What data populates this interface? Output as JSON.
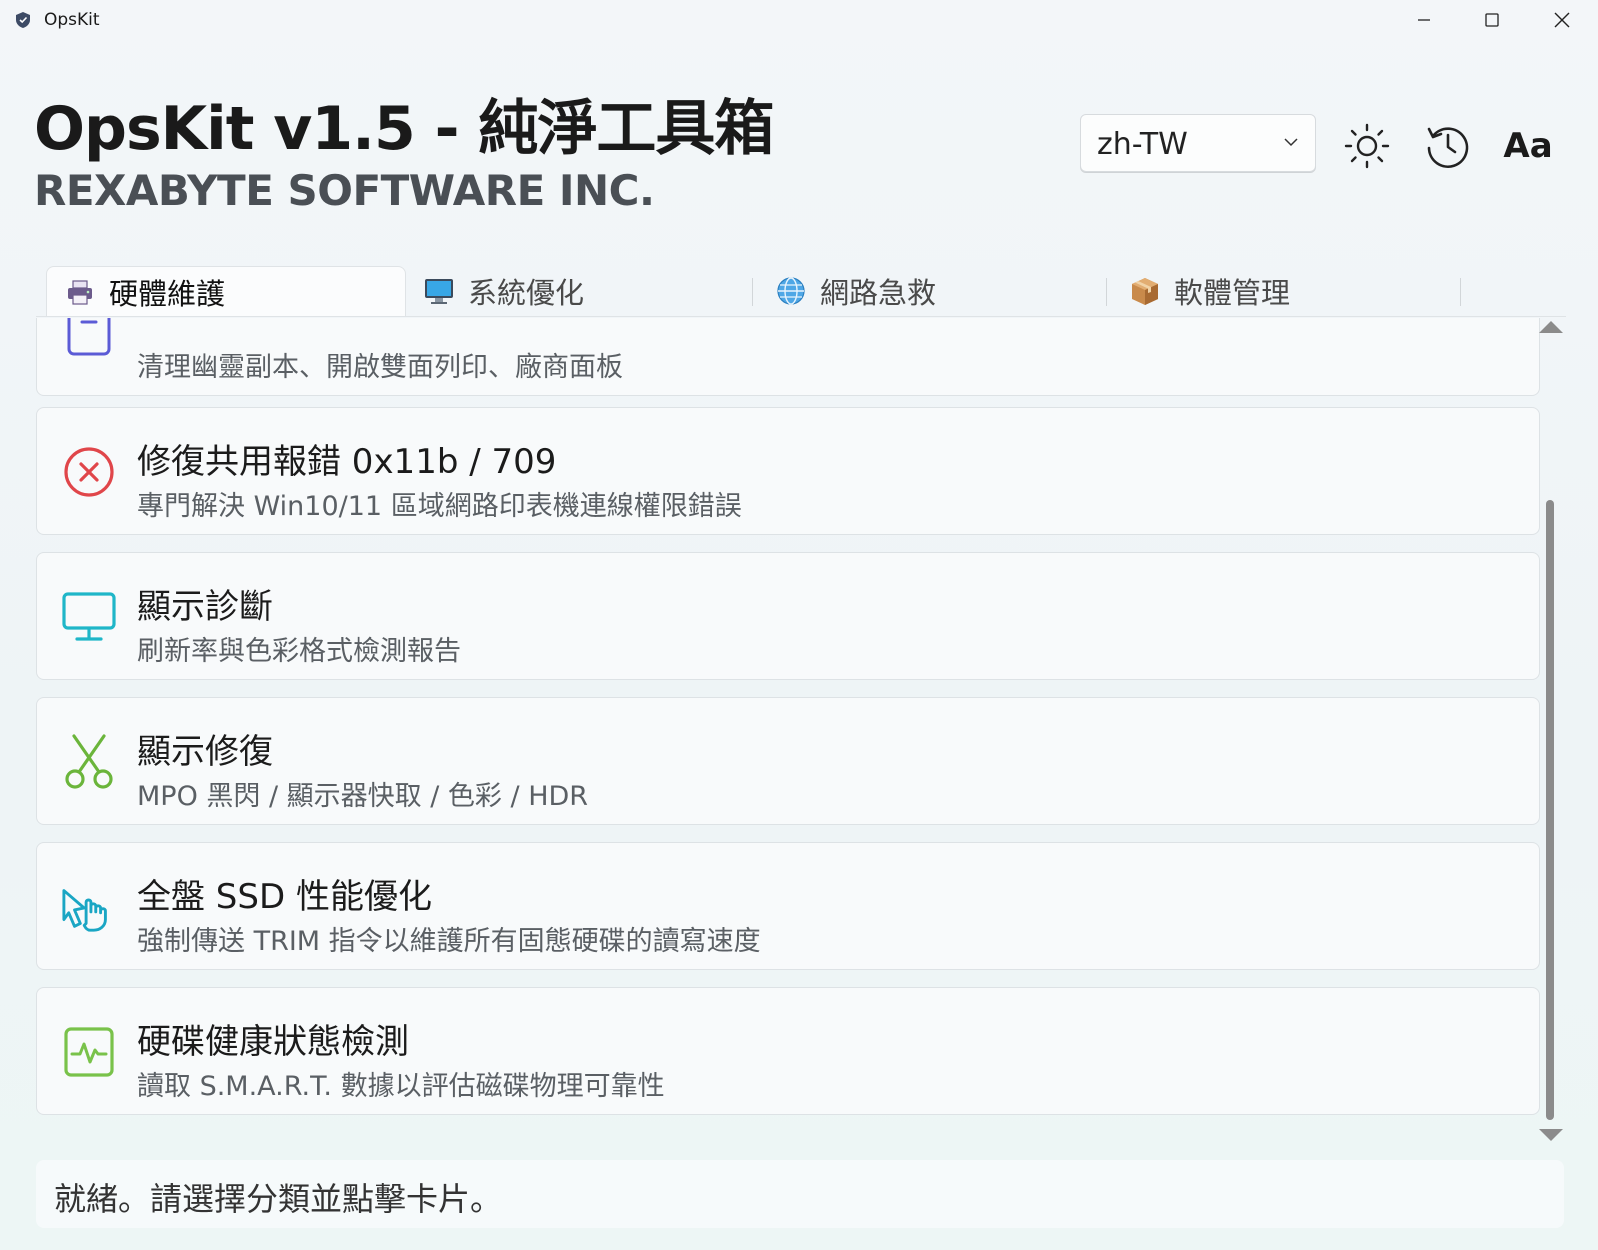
{
  "window": {
    "title": "OpsKit"
  },
  "header": {
    "title": "OpsKit v1.5 - 純淨工具箱",
    "company": "REXABYTE SOFTWARE INC.",
    "language": {
      "value": "zh-TW"
    },
    "font_button_label": "Aa"
  },
  "tabs": [
    {
      "label": "硬體維護",
      "icon": "printer-icon",
      "active": true
    },
    {
      "label": "系統優化",
      "icon": "monitor-icon",
      "active": false
    },
    {
      "label": "網路急救",
      "icon": "globe-icon",
      "active": false
    },
    {
      "label": "軟體管理",
      "icon": "package-icon",
      "active": false
    }
  ],
  "cards": [
    {
      "title": "",
      "desc": "清理幽靈副本、開啟雙面列印、廠商面板",
      "icon": "printer-outline-icon",
      "color": "#5b5bd6"
    },
    {
      "title": "修復共用報錯 0x11b / 709",
      "desc": "專門解決 Win10/11 區域網路印表機連線權限錯誤",
      "icon": "error-circle-icon",
      "color": "#e0464a"
    },
    {
      "title": "顯示診斷",
      "desc": "刷新率與色彩格式檢測報告",
      "icon": "display-icon",
      "color": "#1fb6c8"
    },
    {
      "title": "顯示修復",
      "desc": "MPO 黑閃 / 顯示器快取 / 色彩 / HDR",
      "icon": "scissors-icon",
      "color": "#6bb53b"
    },
    {
      "title": "全盤 SSD 性能優化",
      "desc": "強制傳送 TRIM 指令以維護所有固態硬碟的讀寫速度",
      "icon": "pointer-hand-icon",
      "color": "#1aa6c4"
    },
    {
      "title": "硬碟健康狀態檢測",
      "desc": "讀取 S.M.A.R.T. 數據以評估磁碟物理可靠性",
      "icon": "activity-icon",
      "color": "#79c24a"
    }
  ],
  "status": {
    "text": "就緒。請選擇分類並點擊卡片。"
  }
}
